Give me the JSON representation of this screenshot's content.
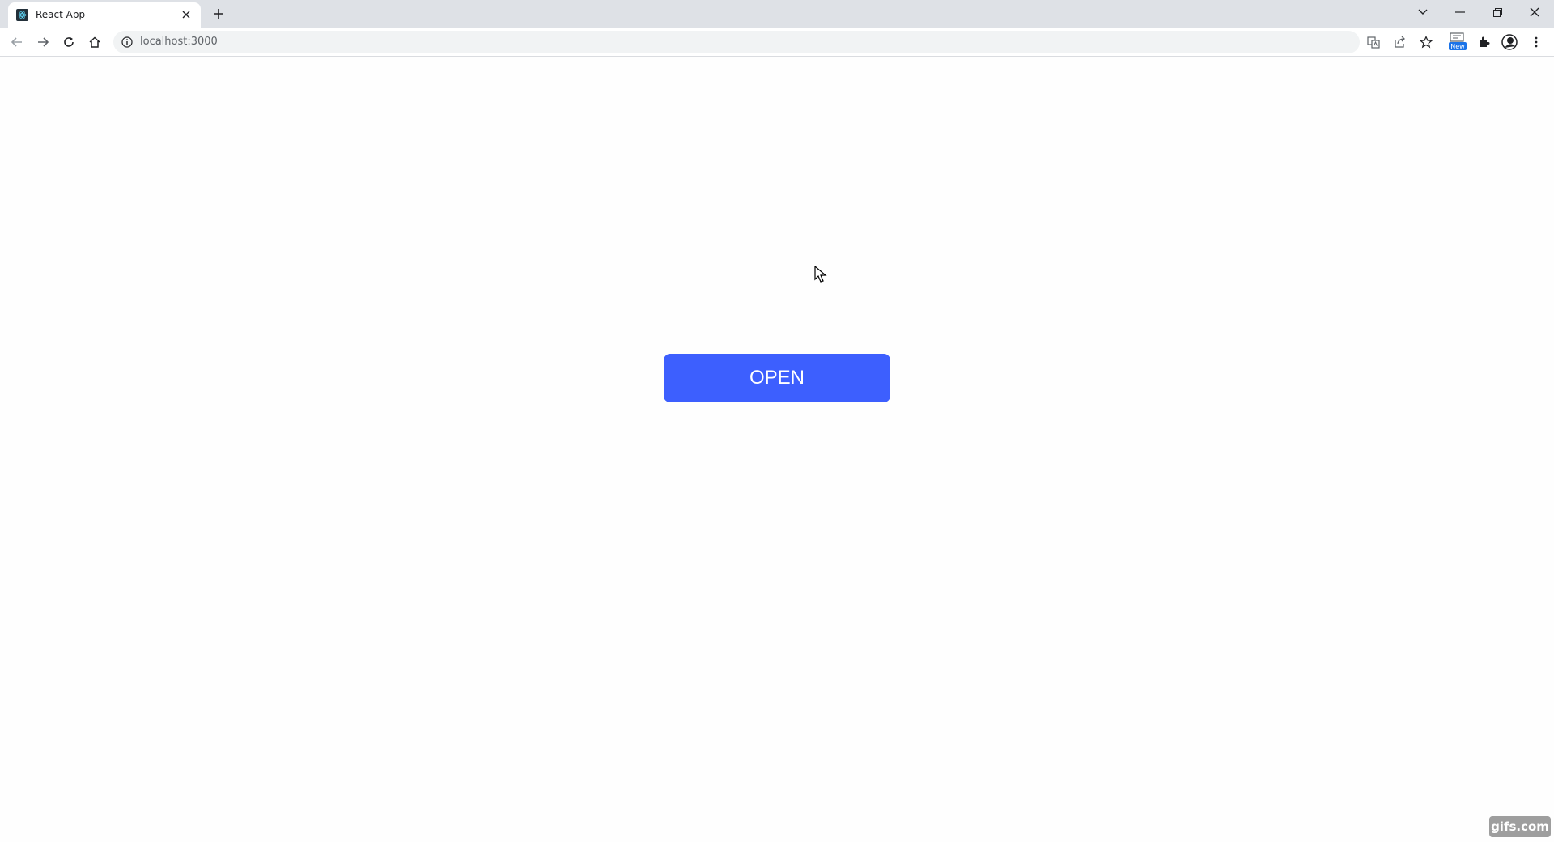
{
  "browser": {
    "tab": {
      "title": "React App",
      "favicon": "react-favicon",
      "close_icon": "close-icon"
    },
    "new_tab_icon": "plus-icon",
    "window_controls": [
      "chevron-down-icon",
      "minimize-icon",
      "restore-icon",
      "close-icon"
    ],
    "toolbar": {
      "back_icon": "back-arrow-icon",
      "forward_icon": "forward-arrow-icon",
      "reload_icon": "reload-icon",
      "home_icon": "home-icon",
      "info_icon": "info-icon",
      "url": "localhost:3000",
      "right_icons": [
        "translate-icon",
        "share-icon",
        "star-icon",
        "reading-mode-icon",
        "extensions-icon",
        "profile-icon",
        "menu-icon"
      ],
      "new_badge": "New"
    }
  },
  "page": {
    "open_button_label": "OPEN"
  },
  "colors": {
    "accent": "#3d5ffe",
    "tabstrip": "#dee1e6",
    "omnibox": "#f1f3f4"
  },
  "watermark": "gifs.com"
}
